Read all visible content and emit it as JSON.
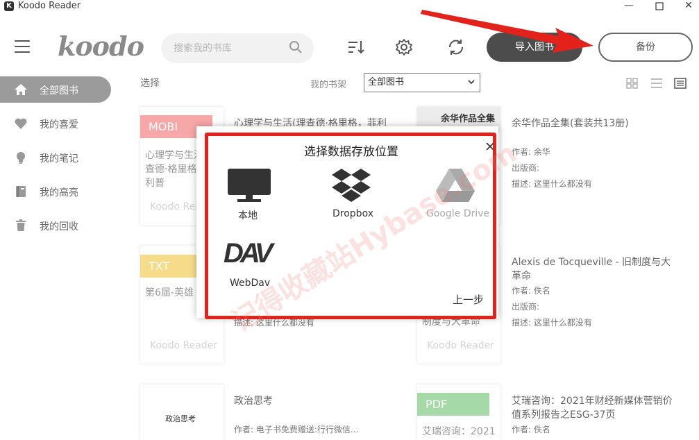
{
  "window": {
    "title": "Koodo Reader",
    "icon_name": "koodo-app-icon",
    "minimize": "—",
    "maximize": "☐",
    "close": "✕"
  },
  "header": {
    "logo": "koodo",
    "search_placeholder": "搜索我的书库",
    "import_label": "导入图书",
    "backup_label": "备份"
  },
  "sidebar": {
    "items": [
      {
        "label": "全部图书",
        "icon": "home-icon",
        "active": true
      },
      {
        "label": "我的喜爱",
        "icon": "heart-icon",
        "active": false
      },
      {
        "label": "我的笔记",
        "icon": "bulb-icon",
        "active": false
      },
      {
        "label": "我的高亮",
        "icon": "highlight-book-icon",
        "active": false
      },
      {
        "label": "我的回收",
        "icon": "trash-icon",
        "active": false
      }
    ]
  },
  "toolbar": {
    "select_label": "选择",
    "shelf_label": "我的书架",
    "shelf_value": "全部图书"
  },
  "books": [
    {
      "format": "MOBI",
      "format_color": "#f8a7a9",
      "cover_title": "心理学与生活(理查德·格里格，菲利普",
      "cover_foot": "Koodo Reader",
      "title": "心理学与生活(理查德·格里格，菲利"
    },
    {
      "cover_title": "余华作品全集",
      "title": "余华作品全集(套装共13册)",
      "author": "作者: 余华",
      "publisher": "出版商:",
      "description": "描述: 这里什么都没有"
    },
    {
      "format": "TXT",
      "format_color": "#f6dc8a",
      "cover_title": "第6届-英雄",
      "cover_foot": "Koodo Reader",
      "description": "描述: 这里什么都没有"
    },
    {
      "cover_title": "制度与大革命",
      "cover_foot": "Koodo Reader",
      "title": "Alexis de Tocqueville - 旧制度与大革命",
      "author": "作者: 佚名",
      "publisher": "出版商:",
      "description": "描述: 这里什么都没有"
    },
    {
      "cover_title": "政治思考",
      "title": "政治思考",
      "author": "作者: 电子书免费赠送:行行微信..."
    },
    {
      "format": "PDF",
      "format_color": "#a6d9a8",
      "cover_title": "艾瑞咨询：2021",
      "title": "艾瑞咨询：2021年财经新媒体营销价值系列报告之ESG-37页",
      "author": "作者: 佚名"
    }
  ],
  "modal": {
    "title": "选择数据存放位置",
    "options": [
      {
        "label": "本地",
        "icon": "monitor-icon"
      },
      {
        "label": "Dropbox",
        "icon": "dropbox-icon"
      },
      {
        "label": "Google Drive",
        "icon": "google-drive-icon",
        "disabled": true
      },
      {
        "label": "WebDav",
        "icon": "webdav-icon",
        "logo_text": "DAV"
      }
    ],
    "prev_step": "上一步"
  },
  "watermark": "记得收藏站Hybase.com",
  "colors": {
    "accent_dark": "#4c4c4c",
    "sidebar_active": "#9b9b9b",
    "annotation_red": "#e3221c"
  }
}
